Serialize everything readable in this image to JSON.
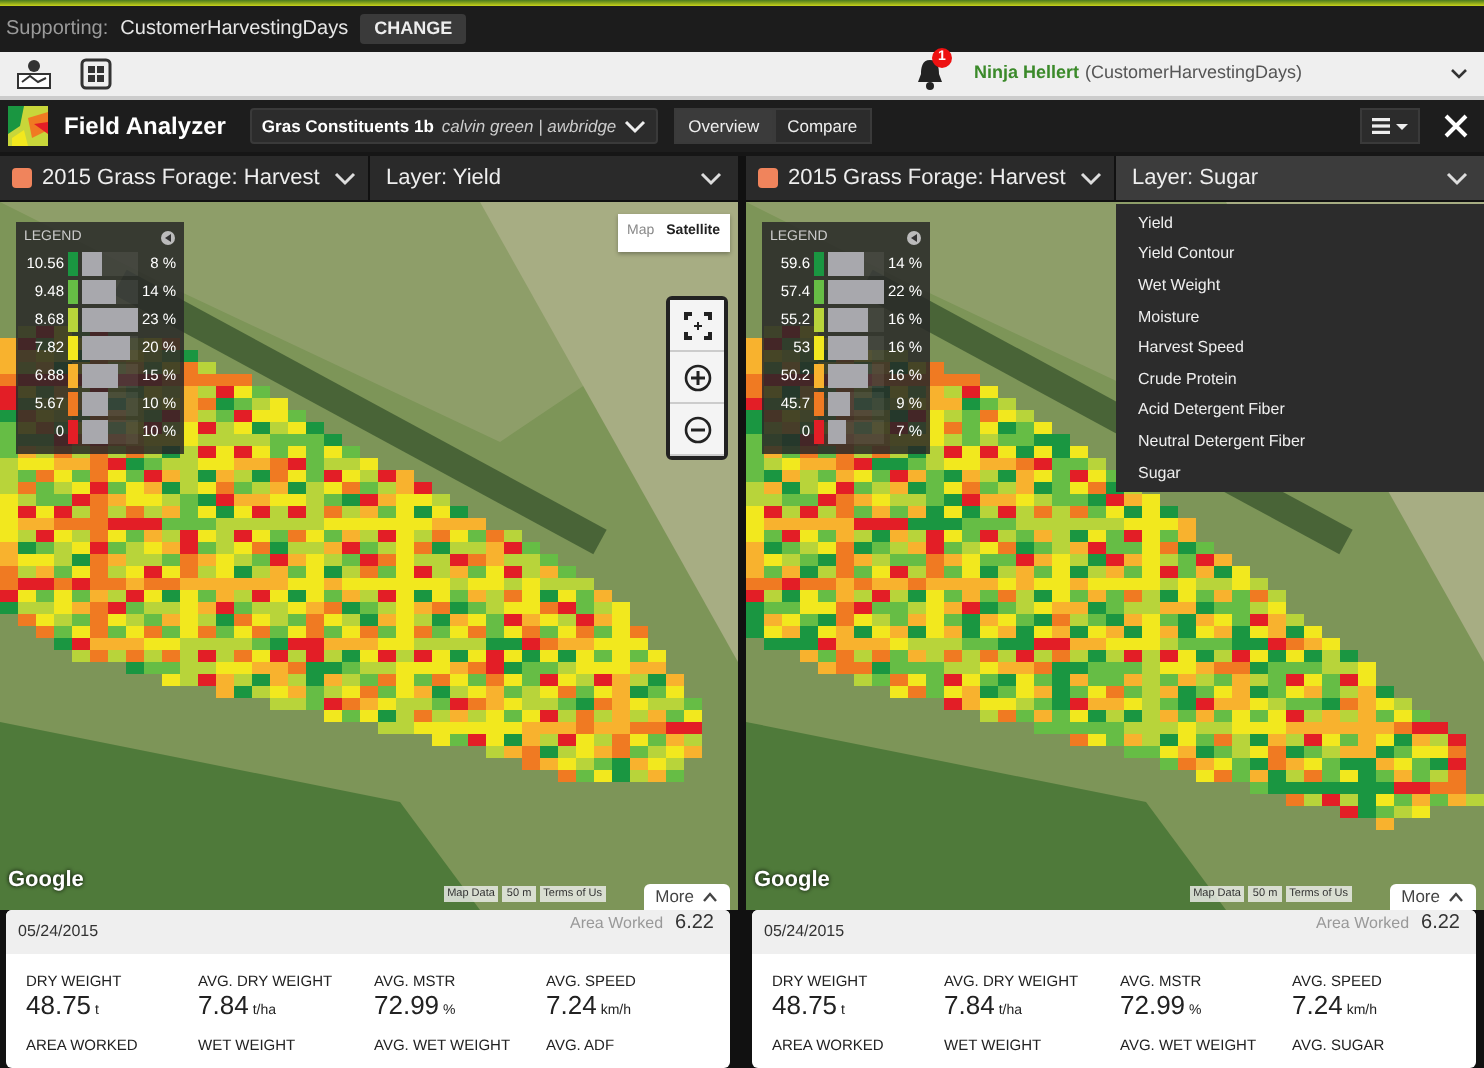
{
  "top_bar": {
    "supporting_label": "Supporting:",
    "supporting_value": "CustomerHarvestingDays",
    "change_button": "CHANGE"
  },
  "toolbar": {
    "notification_count": "1",
    "user_name": "Ninja Hellert",
    "user_context": "(CustomerHarvestingDays)"
  },
  "app_header": {
    "title": "Field Analyzer",
    "dataset": "Gras Constituents 1b",
    "dataset_owner": "calvin green | awbridge",
    "views": [
      {
        "label": "Overview",
        "selected": true
      },
      {
        "label": "Compare",
        "selected": false
      }
    ]
  },
  "panes": [
    {
      "field": "2015 Grass Forage: Harvest",
      "layer": "Layer: Yield",
      "layer_expanded": false,
      "legend": {
        "title": "LEGEND",
        "rows": [
          {
            "value": "10.56",
            "color": "#1a9641",
            "level": 0.35,
            "percent": "8 %"
          },
          {
            "value": "9.48",
            "color": "#66bd45",
            "level": 0.6,
            "percent": "14 %"
          },
          {
            "value": "8.68",
            "color": "#b8d43a",
            "level": 1.0,
            "percent": "23 %"
          },
          {
            "value": "7.82",
            "color": "#f2e81e",
            "level": 0.87,
            "percent": "20 %"
          },
          {
            "value": "6.88",
            "color": "#f8b22e",
            "level": 0.65,
            "percent": "15 %"
          },
          {
            "value": "5.67",
            "color": "#f07a22",
            "level": 0.45,
            "percent": "10 %"
          },
          {
            "value": "0",
            "color": "#e31e26",
            "level": 0.45,
            "percent": "10 %"
          }
        ]
      },
      "map_types": [
        {
          "label": "Map",
          "selected": false
        },
        {
          "label": "Satellite",
          "selected": true
        }
      ],
      "attribution": {
        "logo": "Google",
        "map_data": "Map Data",
        "scale": "50 m",
        "terms": "Terms of Us"
      },
      "summary": {
        "more": "More",
        "date": "05/24/2015",
        "area_label": "Area Worked",
        "area_value": "6.22",
        "stats": [
          {
            "label": "DRY WEIGHT",
            "value": "48.75",
            "unit": "t"
          },
          {
            "label": "AVG. DRY WEIGHT",
            "value": "7.84",
            "unit": "t/ha"
          },
          {
            "label": "AVG. MSTR",
            "value": "72.99",
            "unit": "%"
          },
          {
            "label": "AVG. SPEED",
            "value": "7.24",
            "unit": "km/h"
          },
          {
            "label": "AREA WORKED"
          },
          {
            "label": "WET WEIGHT"
          },
          {
            "label": "AVG. WET WEIGHT"
          },
          {
            "label": "AVG. ADF"
          }
        ]
      }
    },
    {
      "field": "2015 Grass Forage: Harvest",
      "layer": "Layer: Sugar",
      "layer_expanded": true,
      "layer_menu": [
        "Yield",
        "Yield Contour",
        "Wet Weight",
        "Moisture",
        "Harvest Speed",
        "Crude Protein",
        "Acid Detergent Fiber",
        "Neutral Detergent Fiber",
        "Sugar"
      ],
      "legend": {
        "title": "LEGEND",
        "rows": [
          {
            "value": "59.6",
            "color": "#1a9641",
            "level": 0.64,
            "percent": "14 %"
          },
          {
            "value": "57.4",
            "color": "#66bd45",
            "level": 1.0,
            "percent": "22 %"
          },
          {
            "value": "55.2",
            "color": "#b8d43a",
            "level": 0.73,
            "percent": "16 %"
          },
          {
            "value": "53",
            "color": "#f2e81e",
            "level": 0.73,
            "percent": "16 %"
          },
          {
            "value": "50.2",
            "color": "#f8b22e",
            "level": 0.73,
            "percent": "16 %"
          },
          {
            "value": "45.7",
            "color": "#f07a22",
            "level": 0.41,
            "percent": "9 %"
          },
          {
            "value": "0",
            "color": "#e31e26",
            "level": 0.32,
            "percent": "7 %"
          }
        ]
      },
      "attribution": {
        "logo": "Google",
        "map_data": "Map Data",
        "scale": "50 m",
        "terms": "Terms of Us"
      },
      "summary": {
        "more": "More",
        "date": "05/24/2015",
        "area_label": "Area Worked",
        "area_value": "6.22",
        "stats": [
          {
            "label": "DRY WEIGHT",
            "value": "48.75",
            "unit": "t"
          },
          {
            "label": "AVG. DRY WEIGHT",
            "value": "7.84",
            "unit": "t/ha"
          },
          {
            "label": "AVG. MSTR",
            "value": "72.99",
            "unit": "%"
          },
          {
            "label": "AVG. SPEED",
            "value": "7.24",
            "unit": "km/h"
          },
          {
            "label": "AREA WORKED"
          },
          {
            "label": "WET WEIGHT"
          },
          {
            "label": "AVG. WET WEIGHT"
          },
          {
            "label": "AVG. SUGAR"
          }
        ]
      }
    }
  ]
}
